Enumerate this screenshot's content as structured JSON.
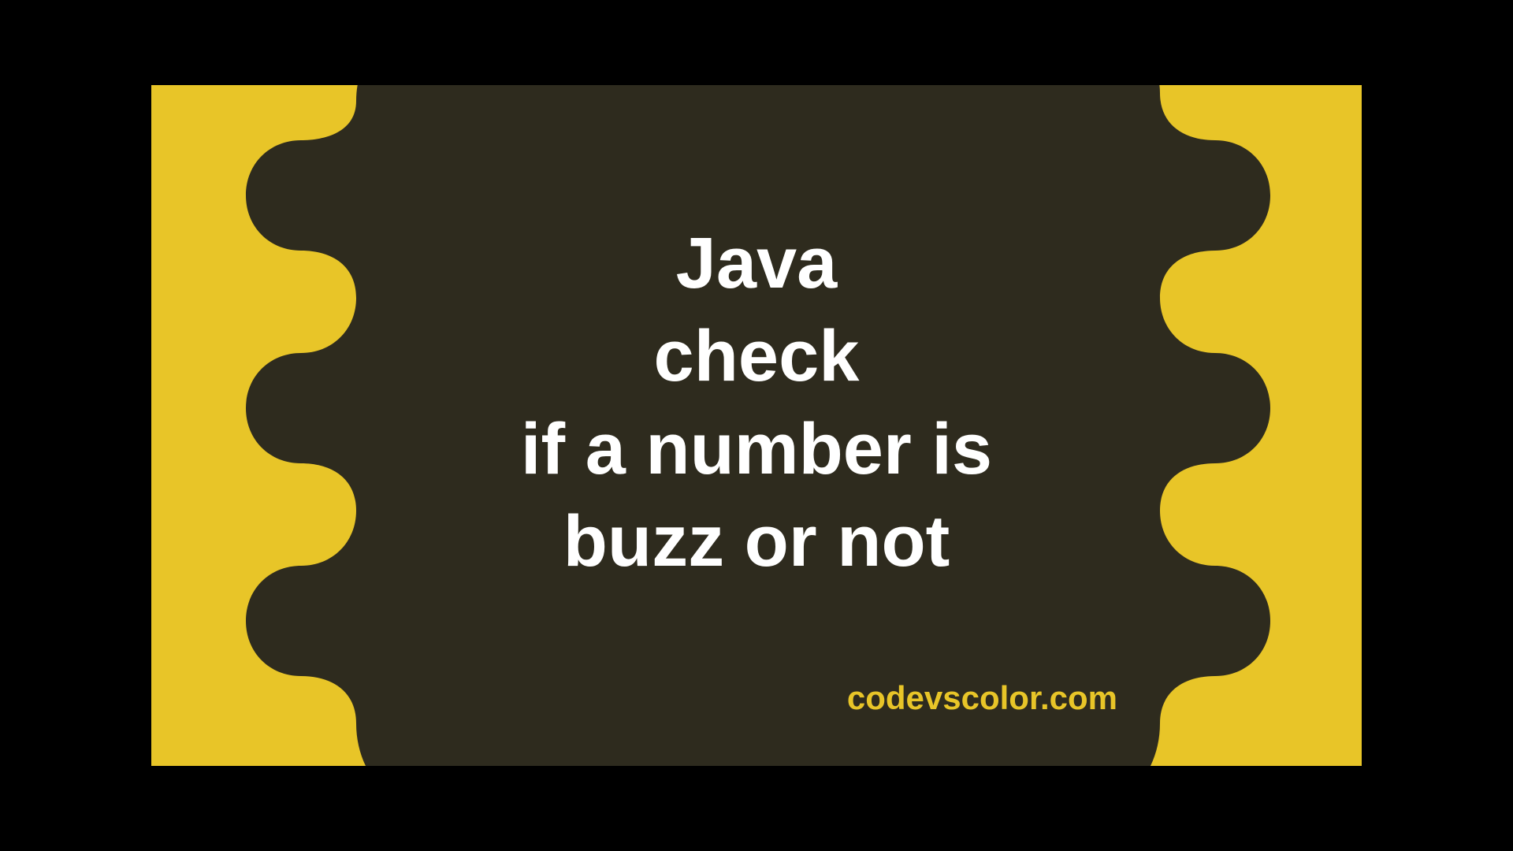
{
  "title_lines": {
    "l1": "Java",
    "l2": "check",
    "l3": "if a number is",
    "l4": "buzz or not"
  },
  "watermark": "codevscolor.com",
  "colors": {
    "background": "#e8c528",
    "blob": "#2e2b1e",
    "text": "#ffffff"
  }
}
